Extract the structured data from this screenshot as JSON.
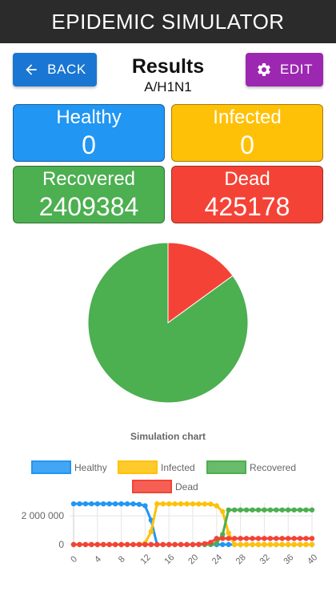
{
  "app": {
    "title": "EPIDEMIC SIMULATOR"
  },
  "toolbar": {
    "back_label": "BACK",
    "edit_label": "EDIT"
  },
  "header": {
    "title": "Results",
    "subtitle": "A/H1N1"
  },
  "stats": {
    "healthy": {
      "label": "Healthy",
      "value": "0"
    },
    "infected": {
      "label": "Infected",
      "value": "0"
    },
    "recovered": {
      "label": "Recovered",
      "value": "2409384"
    },
    "dead": {
      "label": "Dead",
      "value": "425178"
    }
  },
  "colors": {
    "healthy": "#2196f3",
    "infected": "#ffc107",
    "recovered": "#4caf50",
    "dead": "#f44336",
    "back": "#1976d2",
    "edit": "#9c27b0",
    "appbar": "#2b2b2b"
  },
  "icons": {
    "back": "arrow-left-icon",
    "edit": "gear-icon"
  },
  "chart_data": [
    {
      "type": "pie",
      "labels": [
        "Recovered",
        "Dead"
      ],
      "values": [
        2409384,
        425178
      ],
      "colors": [
        "#4caf50",
        "#f44336"
      ]
    },
    {
      "type": "line",
      "title": "Simulation chart",
      "legend_position": "top",
      "x": [
        0,
        1,
        2,
        3,
        4,
        5,
        6,
        7,
        8,
        9,
        10,
        11,
        12,
        13,
        14,
        15,
        16,
        17,
        18,
        19,
        20,
        21,
        22,
        23,
        24,
        25,
        26,
        27,
        28,
        29,
        30,
        31,
        32,
        33,
        34,
        35,
        36,
        37,
        38,
        39,
        40
      ],
      "xticks": [
        "0",
        "4",
        "8",
        "12",
        "16",
        "20",
        "24",
        "28",
        "32",
        "36",
        "40"
      ],
      "yticks": [
        "0",
        "2 000 000"
      ],
      "ylim": [
        0,
        2900000
      ],
      "grid": true,
      "series": [
        {
          "name": "Healthy",
          "color": "#2196f3",
          "values": [
            2834562,
            2834560,
            2834550,
            2834530,
            2834500,
            2834450,
            2834350,
            2834150,
            2833800,
            2833000,
            2830000,
            2800000,
            2700000,
            1700000,
            0,
            0,
            0,
            0,
            0,
            0,
            0,
            0,
            0,
            0,
            0,
            0,
            0,
            0,
            0,
            0,
            0,
            0,
            0,
            0,
            0,
            0,
            0,
            0,
            0,
            0,
            0
          ]
        },
        {
          "name": "Infected",
          "color": "#ffc107",
          "values": [
            0,
            0,
            0,
            0,
            0,
            0,
            0,
            0,
            0,
            100,
            1000,
            20000,
            100000,
            900000,
            2834000,
            2834000,
            2833000,
            2832000,
            2831000,
            2830000,
            2828000,
            2826000,
            2822000,
            2815000,
            2700000,
            2300000,
            800000,
            0,
            0,
            0,
            0,
            0,
            0,
            0,
            0,
            0,
            0,
            0,
            0,
            0,
            0
          ]
        },
        {
          "name": "Recovered",
          "color": "#4caf50",
          "values": [
            0,
            0,
            0,
            0,
            0,
            0,
            0,
            0,
            0,
            0,
            0,
            0,
            0,
            0,
            0,
            0,
            0,
            0,
            0,
            0,
            0,
            0,
            0,
            10000,
            100000,
            700000,
            2409384,
            2409384,
            2409384,
            2409384,
            2409384,
            2409384,
            2409384,
            2409384,
            2409384,
            2409384,
            2409384,
            2409384,
            2409384,
            2409384,
            2409384
          ]
        },
        {
          "name": "Dead",
          "color": "#f44336",
          "values": [
            0,
            0,
            0,
            0,
            0,
            0,
            0,
            0,
            0,
            0,
            0,
            0,
            0,
            0,
            0,
            0,
            0,
            0,
            0,
            0,
            0,
            20000,
            60000,
            150000,
            425178,
            425178,
            425178,
            425178,
            425178,
            425178,
            425178,
            425178,
            425178,
            425178,
            425178,
            425178,
            425178,
            425178,
            425178,
            425178,
            425178
          ]
        }
      ]
    }
  ]
}
